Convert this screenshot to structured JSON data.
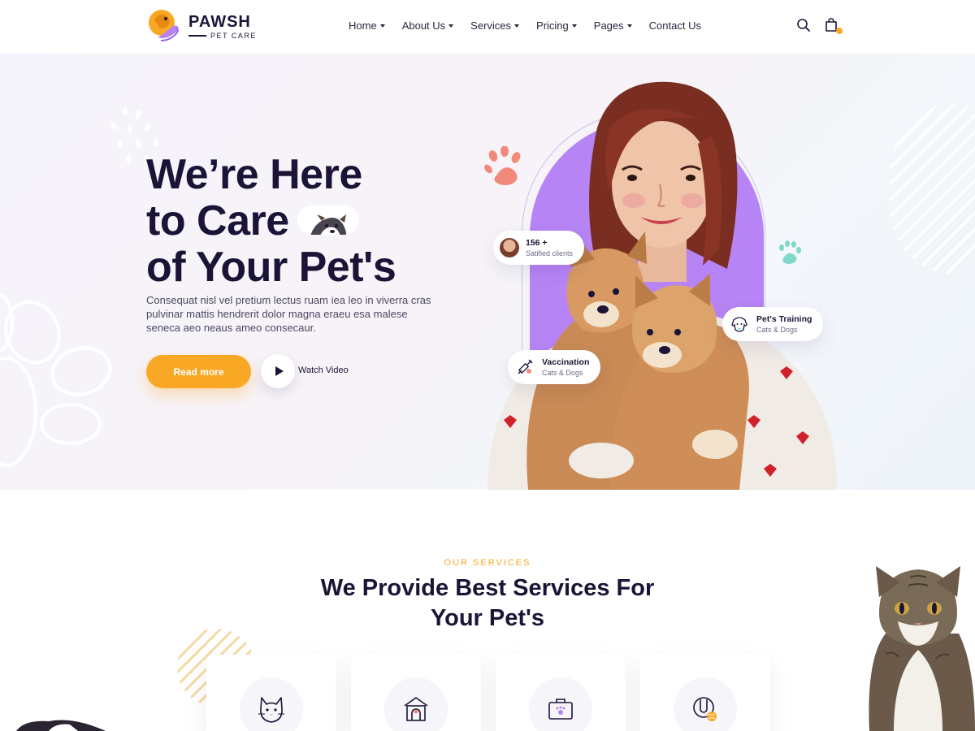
{
  "brand": {
    "name": "PAWSH",
    "tagline": "PET CARE"
  },
  "nav": {
    "items": [
      {
        "label": "Home",
        "dropdown": true
      },
      {
        "label": "About Us",
        "dropdown": true
      },
      {
        "label": "Services",
        "dropdown": true
      },
      {
        "label": "Pricing",
        "dropdown": true
      },
      {
        "label": "Pages",
        "dropdown": true
      },
      {
        "label": "Contact Us",
        "dropdown": false
      }
    ],
    "icons": [
      "search-icon",
      "shopping-bag-icon"
    ]
  },
  "hero": {
    "title_line1": "We’re Here",
    "title_line2": "to Care",
    "title_line3": "of Your Pet's",
    "description": "Consequat nisl vel pretium lectus ruam iea leo in viverra cras pulvinar mattis hendrerit dolor magna eraeu esa malese seneca aeo neaus ameo consecaur.",
    "cta_primary": "Read more",
    "cta_video": "Watch Video",
    "chips": {
      "clients": {
        "title": "156 +",
        "subtitle": "Satified clients"
      },
      "training": {
        "title": "Pet's Training",
        "subtitle": "Cats & Dogs"
      },
      "vaccination": {
        "title": "Vaccination",
        "subtitle": "Cats & Dogs"
      }
    }
  },
  "services": {
    "eyebrow": "OUR SERVICES",
    "title": "We Provide Best Services For Your Pet's",
    "cards": [
      {
        "icon": "cat-face-icon"
      },
      {
        "icon": "pet-house-icon"
      },
      {
        "icon": "pet-carrier-icon"
      },
      {
        "icon": "pet-toy-icon"
      }
    ]
  },
  "colors": {
    "primary_dark": "#1b1437",
    "accent_orange": "#f9a825",
    "accent_purple": "#b784f5",
    "paw_coral": "#f28a7c",
    "paw_teal": "#7fd8c8"
  }
}
